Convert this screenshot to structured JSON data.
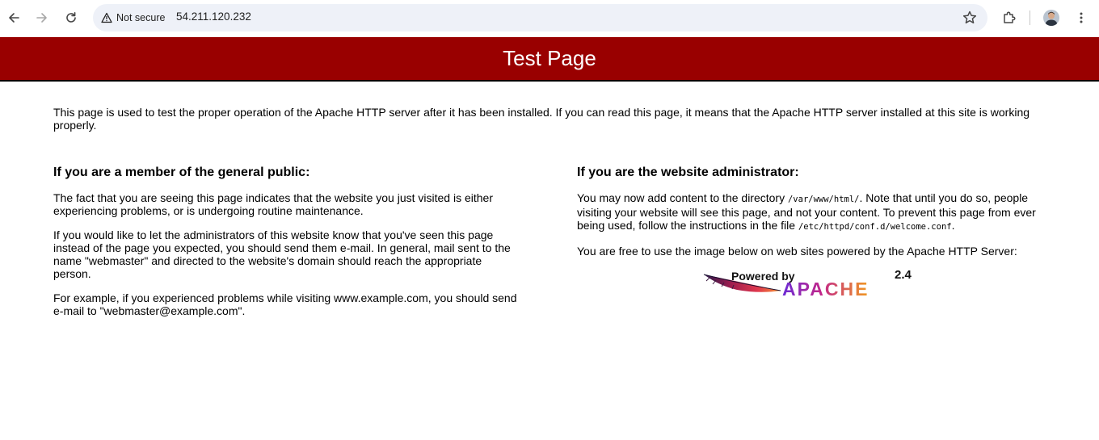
{
  "browser": {
    "security_label": "Not secure",
    "url": "54.211.120.232",
    "icons": [
      "back-icon",
      "forward-icon",
      "reload-icon",
      "warning-triangle-icon",
      "star-icon",
      "extensions-icon",
      "profile-avatar",
      "menu-dots-icon"
    ]
  },
  "page": {
    "banner_title": "Test Page",
    "banner_color": "#990000",
    "intro": "This page is used to test the proper operation of the Apache HTTP server after it has been installed. If you can read this page, it means that the Apache HTTP server installed at this site is working properly.",
    "public": {
      "heading": "If you are a member of the general public:",
      "p1": "The fact that you are seeing this page indicates that the website you just visited is either experiencing problems, or is undergoing routine maintenance.",
      "p2": "If you would like to let the administrators of this website know that you've seen this page instead of the page you expected, you should send them e-mail. In general, mail sent to the name \"webmaster\" and directed to the website's domain should reach the appropriate person.",
      "p3": "For example, if you experienced problems while visiting www.example.com, you should send e-mail to \"webmaster@example.com\"."
    },
    "admin": {
      "heading": "If you are the website administrator:",
      "p1_before": "You may now add content to the directory ",
      "p1_code1": "/var/www/html/",
      "p1_middle": ". Note that until you do so, people visiting your website will see this page, and not your content. To prevent this page from ever being used, follow the instructions in the file ",
      "p1_code2": "/etc/httpd/conf.d/welcome.conf",
      "p1_after": ".",
      "p2": "You are free to use the image below on web sites powered by the Apache HTTP Server:"
    },
    "powered_badge": {
      "line1": "Powered by",
      "version": "2.4",
      "brand": "APACHE"
    }
  }
}
